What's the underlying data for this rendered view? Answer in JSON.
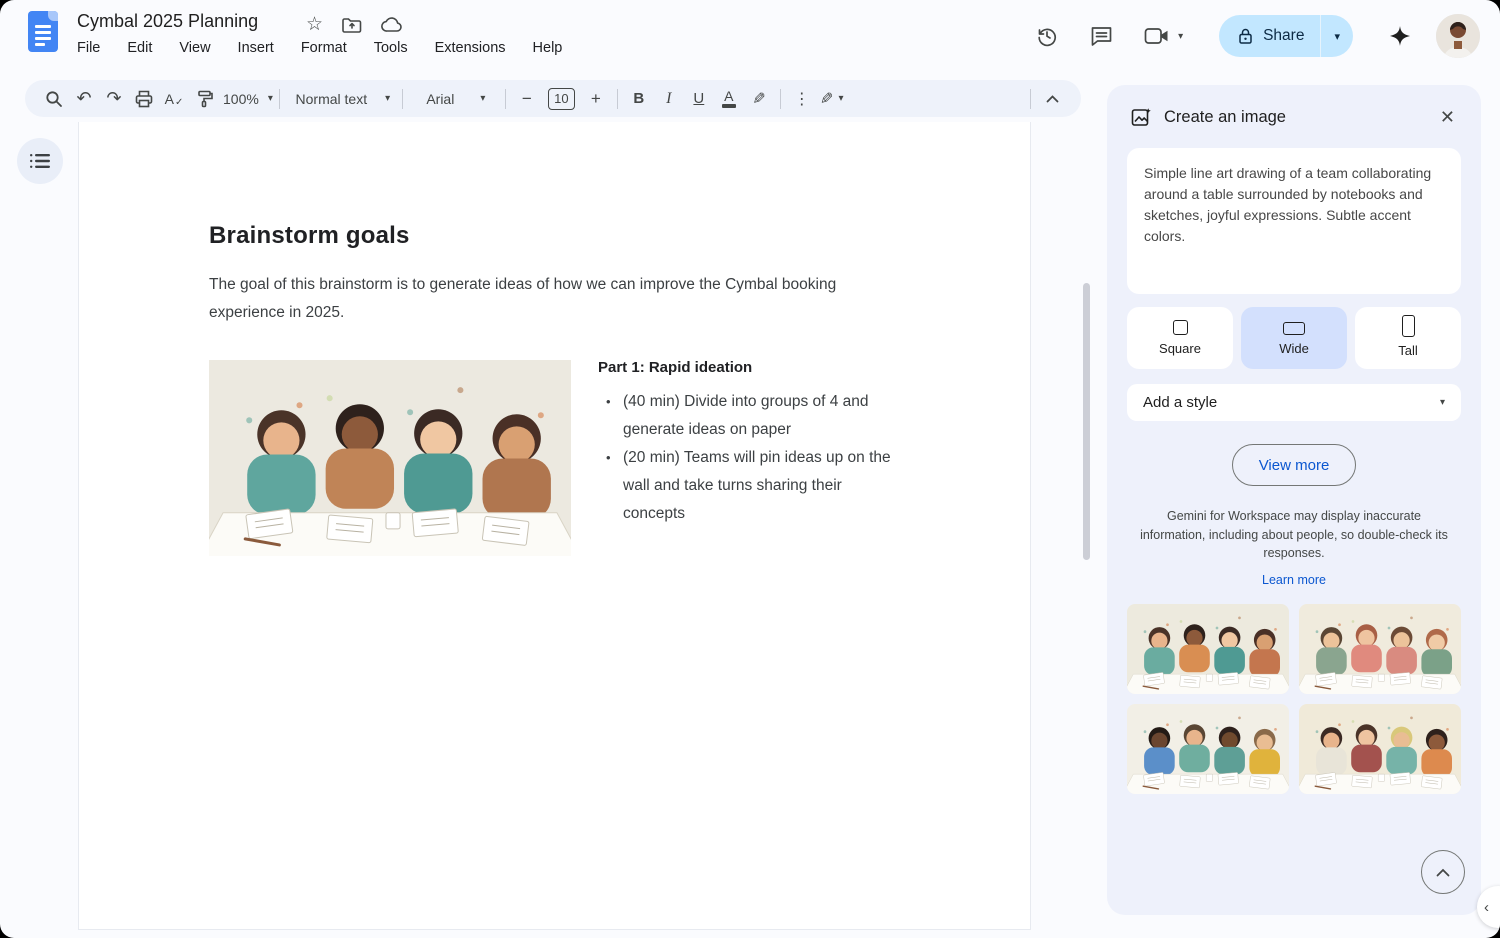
{
  "window": {
    "title": "Cymbal 2025 Planning"
  },
  "topbar": {
    "menus": [
      "File",
      "Edit",
      "View",
      "Insert",
      "Format",
      "Tools",
      "Extensions",
      "Help"
    ],
    "share_label": "Share"
  },
  "toolbar": {
    "zoom_value": "100%",
    "paragraph_style": "Normal text",
    "font_family": "Arial",
    "font_size": "10",
    "bold_label": "B",
    "italic_label": "I",
    "underline_label": "U",
    "text_color_label": "A",
    "spellcheck_label": "A",
    "spellcheck_check": "✓",
    "minus_glyph": "−",
    "plus_glyph": "+",
    "more_glyph": "⋮",
    "undo_glyph": "↶",
    "redo_glyph": "↷",
    "pen_glyph": "✎",
    "highlight_glyph": "✎"
  },
  "icons": {
    "caret_down": "▾",
    "close": "✕",
    "star": "☆",
    "chevron_left": "‹"
  },
  "document": {
    "heading": "Brainstorm goals",
    "intro": "The goal of this brainstorm is to generate ideas of how we can improve the Cymbal booking experience in 2025.",
    "section_title": "Part 1: Rapid ideation",
    "bullets": [
      "(40 min) Divide into groups of 4 and generate ideas on paper",
      "(20 min) Teams will pin ideas up on the wall and take turns sharing their concepts"
    ]
  },
  "sidebar": {
    "title": "Create an image",
    "prompt": "Simple line art drawing of a team collaborating around a table surrounded by notebooks and sketches, joyful expressions. Subtle accent colors.",
    "aspects": [
      {
        "label": "Square",
        "selected": false
      },
      {
        "label": "Wide",
        "selected": true
      },
      {
        "label": "Tall",
        "selected": false
      }
    ],
    "style_placeholder": "Add a style",
    "view_more_label": "View more",
    "disclaimer": "Gemini for Workspace may display inaccurate information, including about people, so double-check its responses.",
    "learn_more_label": "Learn more"
  },
  "colors": {
    "accent_blue": "#0b57d0",
    "share_pill": "#c2e7ff",
    "sidebar_bg": "#eef1fb",
    "selected_aspect": "#d3e0fd",
    "toolbar_bg": "#eef2fa",
    "docs_logo": "#4285f4"
  },
  "illustrations": {
    "doc_image": {
      "bg": "#ece9e0",
      "people": [
        {
          "skin": "#e8b48c",
          "hair": "#4a3328",
          "shirt": "#5fa69e"
        },
        {
          "skin": "#8d5a3b",
          "hair": "#2e211c",
          "shirt": "#c08457"
        },
        {
          "skin": "#f0c7a2",
          "hair": "#3b2a24",
          "shirt": "#4f9a93"
        },
        {
          "skin": "#d9a072",
          "hair": "#4a3026",
          "shirt": "#b0764f"
        }
      ]
    },
    "thumb_0": {
      "bg": "#edeade",
      "people": [
        {
          "skin": "#e8b48c",
          "hair": "#4a3328",
          "shirt": "#6aaca0"
        },
        {
          "skin": "#8d5a3b",
          "hair": "#2e211c",
          "shirt": "#d98e52"
        },
        {
          "skin": "#f0c7a2",
          "hair": "#3b2a24",
          "shirt": "#4f9a93"
        },
        {
          "skin": "#d9a072",
          "hair": "#4a3026",
          "shirt": "#c4764e"
        }
      ]
    },
    "thumb_1": {
      "bg": "#f0ebdd",
      "people": [
        {
          "skin": "#ecc39a",
          "hair": "#5a4634",
          "shirt": "#8aa58f"
        },
        {
          "skin": "#efc4a0",
          "hair": "#a85f45",
          "shirt": "#e08a7e"
        },
        {
          "skin": "#ecc39a",
          "hair": "#6b4a35",
          "shirt": "#d98b80"
        },
        {
          "skin": "#f0cba6",
          "hair": "#b06a4a",
          "shirt": "#7ba188"
        }
      ]
    },
    "thumb_2": {
      "bg": "#f2efe6",
      "people": [
        {
          "skin": "#6b4630",
          "hair": "#241b16",
          "shirt": "#5b8fc9"
        },
        {
          "skin": "#e8b48c",
          "hair": "#5a4634",
          "shirt": "#6fae9f"
        },
        {
          "skin": "#704a2e",
          "hair": "#2e211c",
          "shirt": "#5e9f96"
        },
        {
          "skin": "#e9bd93",
          "hair": "#8a6a4a",
          "shirt": "#e0b33c"
        }
      ]
    },
    "thumb_3": {
      "bg": "#f0ead9",
      "people": [
        {
          "skin": "#e8b48c",
          "hair": "#3b2a24",
          "shirt": "#e8e4d8"
        },
        {
          "skin": "#efc4a0",
          "hair": "#4a3328",
          "shirt": "#a3524e"
        },
        {
          "skin": "#e9bd93",
          "hair": "#d9c87a",
          "shirt": "#76b3a8"
        },
        {
          "skin": "#8d5a3b",
          "hair": "#2e211c",
          "shirt": "#dd8a4e"
        }
      ]
    }
  }
}
